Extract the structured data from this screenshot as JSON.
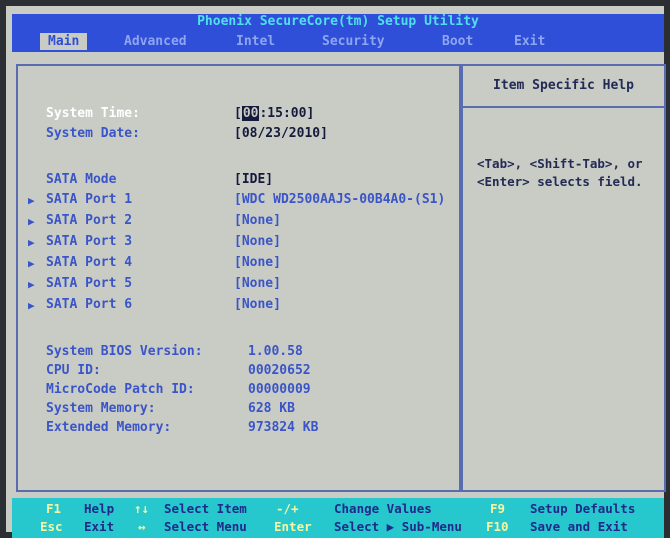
{
  "window": {
    "title": "Phoenix SecureCore(tm) Setup Utility"
  },
  "menu": {
    "tabs": [
      {
        "label": "Main",
        "active": true
      },
      {
        "label": "Advanced"
      },
      {
        "label": "Intel"
      },
      {
        "label": "Security"
      },
      {
        "label": "Boot"
      },
      {
        "label": "Exit"
      }
    ]
  },
  "main": {
    "system_time": {
      "label": "System Time:",
      "cursor": "00",
      "rest": ":15:00]",
      "open": "["
    },
    "system_date": {
      "label": "System Date:",
      "value": "[08/23/2010]"
    },
    "sata_mode": {
      "label": "SATA Mode",
      "value": "[IDE]"
    },
    "sata_ports": [
      {
        "label": "SATA Port 1",
        "value": "[WDC WD2500AAJS-00B4A0-(S1)"
      },
      {
        "label": "SATA Port 2",
        "value": "[None]"
      },
      {
        "label": "SATA Port 3",
        "value": "[None]"
      },
      {
        "label": "SATA Port 4",
        "value": "[None]"
      },
      {
        "label": "SATA Port 5",
        "value": "[None]"
      },
      {
        "label": "SATA Port 6",
        "value": "[None]"
      }
    ],
    "info": [
      {
        "label": "System BIOS Version:",
        "value": "1.00.58"
      },
      {
        "label": "CPU ID:",
        "value": "00020652"
      },
      {
        "label": "MicroCode Patch ID:",
        "value": "00000009"
      },
      {
        "label": "System Memory:",
        "value": "628 KB"
      },
      {
        "label": "Extended Memory:",
        "value": "973824 KB"
      }
    ],
    "arrow_glyph": "▶"
  },
  "help": {
    "title": "Item Specific Help",
    "lines": [
      "<Tab>, <Shift-Tab>, or",
      "<Enter> selects field."
    ]
  },
  "footer": {
    "items": [
      {
        "key": "F1",
        "desc": "Help"
      },
      {
        "key": "↑↓",
        "desc": "Select Item"
      },
      {
        "key": "-/+",
        "desc": "Change Values"
      },
      {
        "key": "F9",
        "desc": "Setup Defaults"
      },
      {
        "key": "Esc",
        "desc": "Exit"
      },
      {
        "key": "↔",
        "desc": "Select Menu"
      },
      {
        "key": "Enter",
        "desc": "Select ▶ Sub-Menu"
      },
      {
        "key": "F10",
        "desc": "Save and Exit"
      }
    ]
  },
  "colors": {
    "bios_blue": "#2f4fd8",
    "title_text": "#4fe0ec",
    "background": "#c9cbc5",
    "footer_cyan": "#27c7ce",
    "label_blue": "#3a55c8"
  }
}
